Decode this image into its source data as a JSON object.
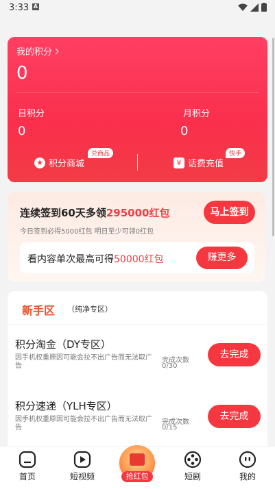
{
  "status_bar": {
    "time": "3:33",
    "notif_glyph": "A"
  },
  "points_card": {
    "title": "我的积分",
    "total": "0",
    "day_label": "日积分",
    "day_value": "0",
    "month_label": "月积分",
    "month_value": "0",
    "mall_label": "积分商城",
    "mall_tag": "兑商品",
    "recharge_label": "话费充值",
    "recharge_tag": "快手"
  },
  "signin": {
    "title_prefix": "连续签到60天多领",
    "title_highlight": "295000红包",
    "subtitle": "今日签到必得5000红包 明日至少可领0红包",
    "button": "马上签到",
    "watch_prefix": "看内容单次最高可得",
    "watch_highlight": "50000红包",
    "watch_button": "赚更多"
  },
  "newbie": {
    "title": "新手区",
    "subtitle": "（纯净专区）",
    "tasks": [
      {
        "title": "积分淘金（DY专区）",
        "desc": "因手机权重原因可能会拉不出广告而无法取广告",
        "count_label": "完成次数",
        "count": "0/30",
        "button": "去完成"
      },
      {
        "title": "积分速递（YLH专区）",
        "desc": "因手机权重原因可能会拉不出广告而无法取广告",
        "count_label": "完成次数",
        "count": "0/15",
        "button": "去完成"
      }
    ]
  },
  "bottom_nav": {
    "home": "首页",
    "short_video": "短视频",
    "red_packet": "抢红包",
    "short_drama": "短剧",
    "mine": "我的"
  },
  "colors": {
    "accent_red": "#f5383f",
    "card_gradient_top": "#ff3f63",
    "newbie_orange": "#e8542c"
  }
}
